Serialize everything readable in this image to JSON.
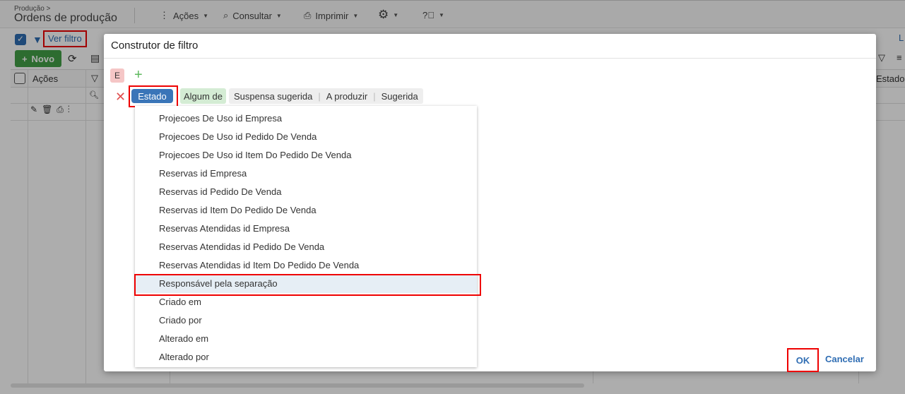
{
  "header": {
    "breadcrumb": "Produção >",
    "title": "Ordens de produção",
    "menu": [
      {
        "label": "Ações",
        "icon": "more-vertical-icon"
      },
      {
        "label": "Consultar",
        "icon": "search-list-icon"
      },
      {
        "label": "Imprimir",
        "icon": "printer-icon"
      },
      {
        "label": "",
        "icon": "gear-icon"
      },
      {
        "label": "",
        "icon": "help-circle-icon"
      }
    ]
  },
  "filter_bar": {
    "ver_filtro": "Ver filtro",
    "right_label": "L"
  },
  "toolbar": {
    "novo_label": "Novo"
  },
  "grid": {
    "acoes_header": "Ações",
    "estado_header": "Estado"
  },
  "dialog": {
    "title": "Construtor de filtro",
    "group_badge": "E",
    "field": "Estado",
    "operator": "Algum de",
    "values": [
      "Suspensa sugerida",
      "A produzir",
      "Sugerida"
    ],
    "ok_label": "OK",
    "cancel_label": "Cancelar"
  },
  "dropdown": {
    "items": [
      "Projecoes De Uso id Empresa",
      "Projecoes De Uso id Pedido De Venda",
      "Projecoes De Uso id Item Do Pedido De Venda",
      "Reservas id Empresa",
      "Reservas id Pedido De Venda",
      "Reservas id Item Do Pedido De Venda",
      "Reservas Atendidas id Empresa",
      "Reservas Atendidas id Pedido De Venda",
      "Reservas Atendidas id Item Do Pedido De Venda",
      "Responsável pela separação",
      "Criado em",
      "Criado por",
      "Alterado em",
      "Alterado por"
    ],
    "highlighted_index": 9
  }
}
